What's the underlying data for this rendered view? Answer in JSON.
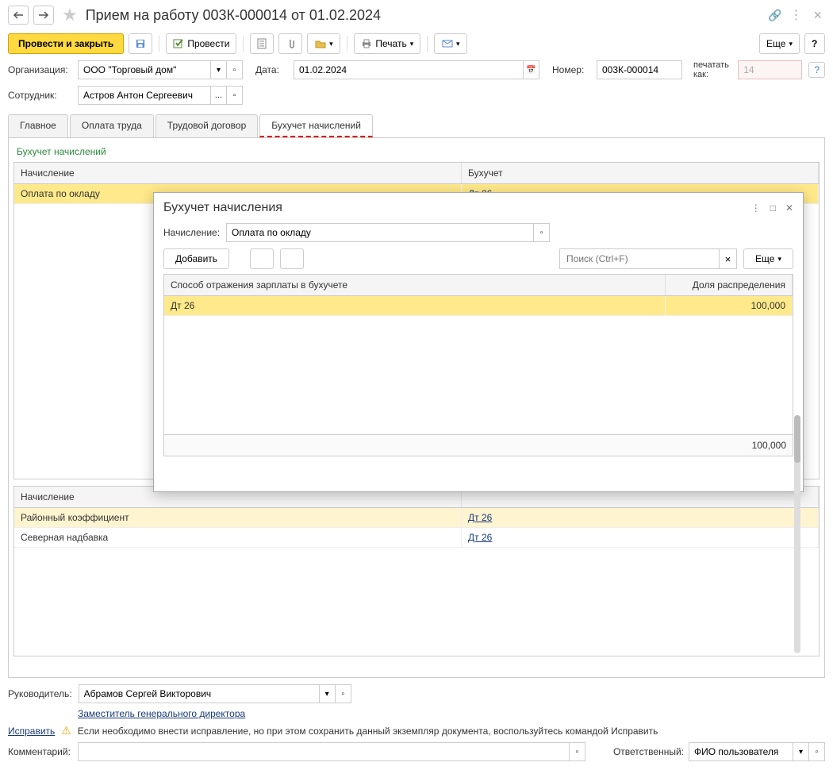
{
  "header": {
    "title": "Прием на работу 003К-000014 от 01.02.2024"
  },
  "toolbar": {
    "primary": "Провести и закрыть",
    "post": "Провести",
    "print": "Печать",
    "more": "Еще"
  },
  "form": {
    "org_label": "Организация:",
    "org_value": "ООО \"Торговый дом\"",
    "date_label": "Дата:",
    "date_value": "01.02.2024",
    "num_label": "Номер:",
    "num_value": "003К-000014",
    "print_as_label": "печатать как:",
    "print_as_value": "14",
    "emp_label": "Сотрудник:",
    "emp_value": "Астров Антон Сергеевич"
  },
  "tabs": {
    "t1": "Главное",
    "t2": "Оплата труда",
    "t3": "Трудовой договор",
    "t4": "Бухучет начислений"
  },
  "section": {
    "title": "Бухучет начислений",
    "col_accrual": "Начисление",
    "col_account": "Бухучет",
    "rows": [
      {
        "name": "Оплата по окладу",
        "acc": "Дт 26"
      }
    ],
    "lower_rows": [
      {
        "name": "Районный коэффициент",
        "acc": "Дт 26"
      },
      {
        "name": "Северная надбавка",
        "acc": "Дт 26"
      }
    ]
  },
  "footer": {
    "manager_label": "Руководитель:",
    "manager_value": "Абрамов Сергей Викторович",
    "position": "Заместитель генерального директора",
    "fix_link": "Исправить",
    "fix_text": "Если необходимо внести исправление, но при этом сохранить данный экземпляр документа, воспользуйтесь командой Исправить",
    "comment_label": "Комментарий:",
    "resp_label": "Ответственный:",
    "resp_value": "ФИО пользователя"
  },
  "dialog": {
    "title": "Бухучет начисления",
    "accrual_label": "Начисление:",
    "accrual_value": "Оплата по окладу",
    "add_btn": "Добавить",
    "search_placeholder": "Поиск (Ctrl+F)",
    "more": "Еще",
    "col1": "Способ отражения зарплаты в бухучете",
    "col2": "Доля распределения",
    "row_name": "Дт 26",
    "row_val": "100,000",
    "total": "100,000"
  }
}
